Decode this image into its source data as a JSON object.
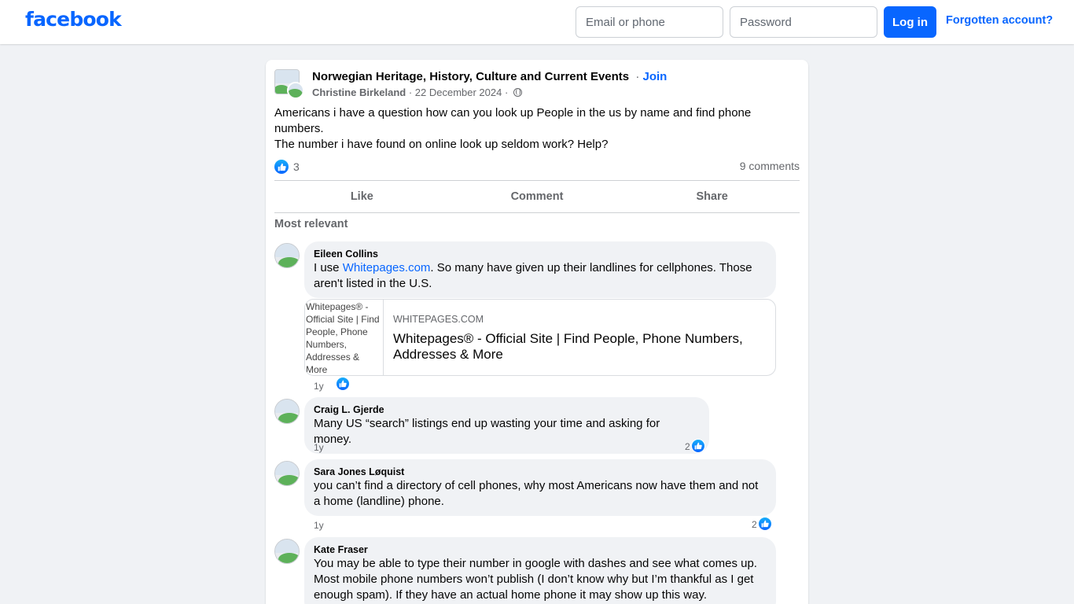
{
  "header": {
    "logo": "facebook",
    "email_placeholder": "Email or phone",
    "password_placeholder": "Password",
    "login_label": "Log in",
    "forgot_label": "Forgotten account?"
  },
  "post": {
    "group_name": "Norwegian Heritage, History, Culture and Current Events",
    "join_separator": "·",
    "join_label": "Join",
    "author": "Christine Birkeland",
    "date": "· 22 December 2024 ·",
    "body_line1": "Americans i have a question how can you look up People in the us by name and find phone numbers.",
    "body_line2": "The number i have found on online look up seldom work? Help?",
    "reaction_count": "3",
    "comment_count": "9 comments",
    "actions": {
      "like": "Like",
      "comment": "Comment",
      "share": "Share"
    },
    "sort_label": "Most relevant"
  },
  "comments": [
    {
      "author": "Eileen Collins",
      "text_before_link": "I use ",
      "link_text": "Whitepages.com",
      "text_after_link": ". So many have given up their landlines for cellphones. Those aren't listed in the U.S.",
      "time": "1y",
      "likes": "",
      "preview": {
        "thumb_alt": "Whitepages® - Official Site | Find People, Phone Numbers, Addresses & More",
        "domain": "WHITEPAGES.COM",
        "title": "Whitepages® - Official Site | Find People, Phone Numbers, Addresses & More"
      }
    },
    {
      "author": "Craig L. Gjerde",
      "text": "Many US “search” listings end up wasting your time and asking for money.",
      "time": "1y",
      "likes": "2"
    },
    {
      "author": "Sara Jones Løquist",
      "text": "you can’t find a directory of cell phones, why most Americans now have them and not a home (landline) phone.",
      "time": "1y",
      "likes": "2"
    },
    {
      "author": "Kate Fraser",
      "text": "You may be able to type their number in google with dashes and see what comes up. Most mobile phone numbers won’t publish (I don’t know why but I’m thankful as I get enough spam). If they have an actual home phone it may show up this way.",
      "time": "",
      "likes": ""
    }
  ],
  "icons": {
    "like": "thumbs-up-icon",
    "audience": "globe-icon"
  },
  "colors": {
    "brand": "#0866ff",
    "background": "#f0f2f5",
    "bubble": "#f0f2f5",
    "muted_text": "#65676b"
  }
}
